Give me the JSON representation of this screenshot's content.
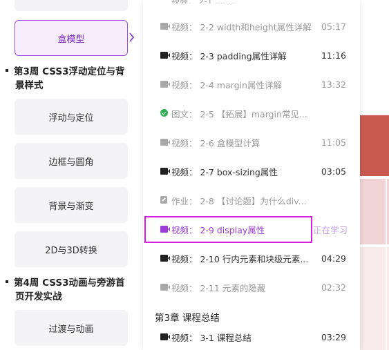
{
  "left": {
    "top_card": "",
    "active_card": "盒模型",
    "week3_title": "第3周 CSS3浮动定位与背景样式",
    "week3_title_line1": "第3周 CSS3浮动定位与背",
    "week3_title_line2": "景样式",
    "week3_items": [
      "浮动与定位",
      "边框与圆角",
      "背景与渐变",
      "2D与3D转换"
    ],
    "week4_title_line1": "第4周 CSS3动画与旁游首",
    "week4_title_line2": "页开发实战",
    "week4_items": [
      "过渡与动画"
    ]
  },
  "list": {
    "rows": [
      {
        "label": "视频：  2-2 width和height属性详解",
        "duration": "05:17",
        "type": "video",
        "state": "done"
      },
      {
        "label": "视频：  2-3 padding属性详解",
        "duration": "11:16",
        "type": "video",
        "state": "todo"
      },
      {
        "label": "视频：  2-4 margin属性详解",
        "duration": "13:32",
        "type": "video",
        "state": "done"
      },
      {
        "label": "图文：  2-5 【拓展】margin常见...",
        "duration": "",
        "type": "article",
        "state": "done"
      },
      {
        "label": "视频：  2-6 盒模型计算",
        "duration": "11:05",
        "type": "video",
        "state": "done"
      },
      {
        "label": "视频：  2-7 box-sizing属性",
        "duration": "03:05",
        "type": "video",
        "state": "todo"
      },
      {
        "label": "作业：  2-8 【讨论题】为什么div...",
        "duration": "",
        "type": "task",
        "state": "done"
      },
      {
        "label": "视频：  2-9 display属性",
        "duration": "正在学习",
        "type": "video",
        "state": "current"
      },
      {
        "label": "视频：  2-10 行内元素和块级元素...",
        "duration": "04:29",
        "type": "video",
        "state": "todo"
      },
      {
        "label": "视频：  2-11 元素的隐藏",
        "duration": "02:32",
        "type": "video",
        "state": "done"
      }
    ],
    "chapter3_title": "第3章  课程总结",
    "chapter3_rows": [
      {
        "label": "视频：  3-1 课程总结",
        "duration": "03:29",
        "type": "video",
        "state": "todo"
      }
    ]
  },
  "colors": {
    "accent": "#9b3dd6",
    "highlight_box": "#d81de0",
    "done_text": "#9a9a9a",
    "deco_red": "#c95a4f",
    "deco_pink": "#f0d3d4"
  }
}
